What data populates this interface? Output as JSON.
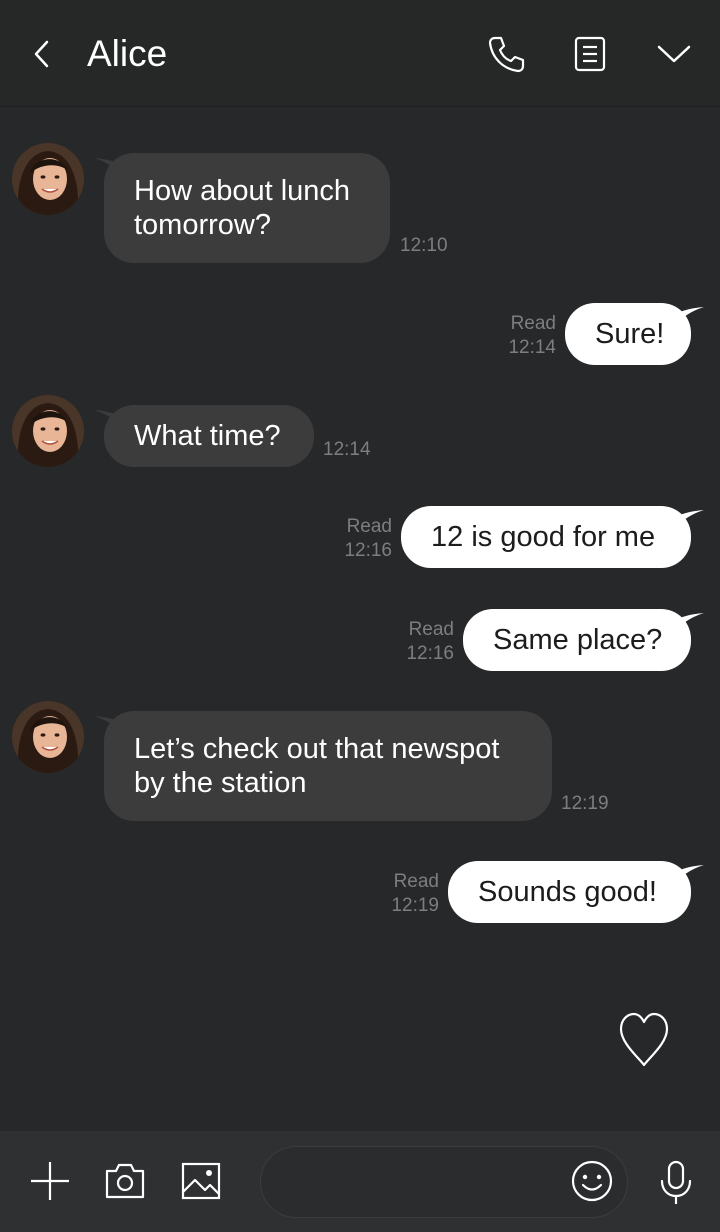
{
  "header": {
    "title": "Alice",
    "back_icon": "chevron-left-icon",
    "call_icon": "phone-icon",
    "notes_icon": "notes-icon",
    "menu_icon": "chevron-down-icon"
  },
  "messages": [
    {
      "direction": "incoming",
      "text_lines": [
        "How about lunch",
        "tomorrow?"
      ],
      "time": "12:10"
    },
    {
      "direction": "outgoing",
      "text": "Sure!",
      "read": "Read",
      "time": "12:14"
    },
    {
      "direction": "incoming",
      "text_lines": [
        "What time?"
      ],
      "time": "12:14"
    },
    {
      "direction": "outgoing",
      "text": "12 is good for me",
      "read": "Read",
      "time": "12:16"
    },
    {
      "direction": "outgoing",
      "text": "Same place?",
      "read": "Read",
      "time": "12:16"
    },
    {
      "direction": "incoming",
      "text_lines": [
        "Let’s check out that newspot",
        "by the station"
      ],
      "time": "12:19"
    },
    {
      "direction": "outgoing",
      "text": "Sounds good!",
      "read": "Read",
      "time": "12:19"
    }
  ],
  "like_icon": "heart-icon",
  "bottom_bar": {
    "icons": [
      "plus-icon",
      "camera-icon",
      "image-icon",
      "emoji-icon",
      "microphone-icon"
    ],
    "input_value": ""
  },
  "colors": {
    "background": "#26282a",
    "incoming_bubble": "#3c3c3c",
    "outgoing_bubble": "#ffffff",
    "meta_text": "#7c7e80"
  }
}
